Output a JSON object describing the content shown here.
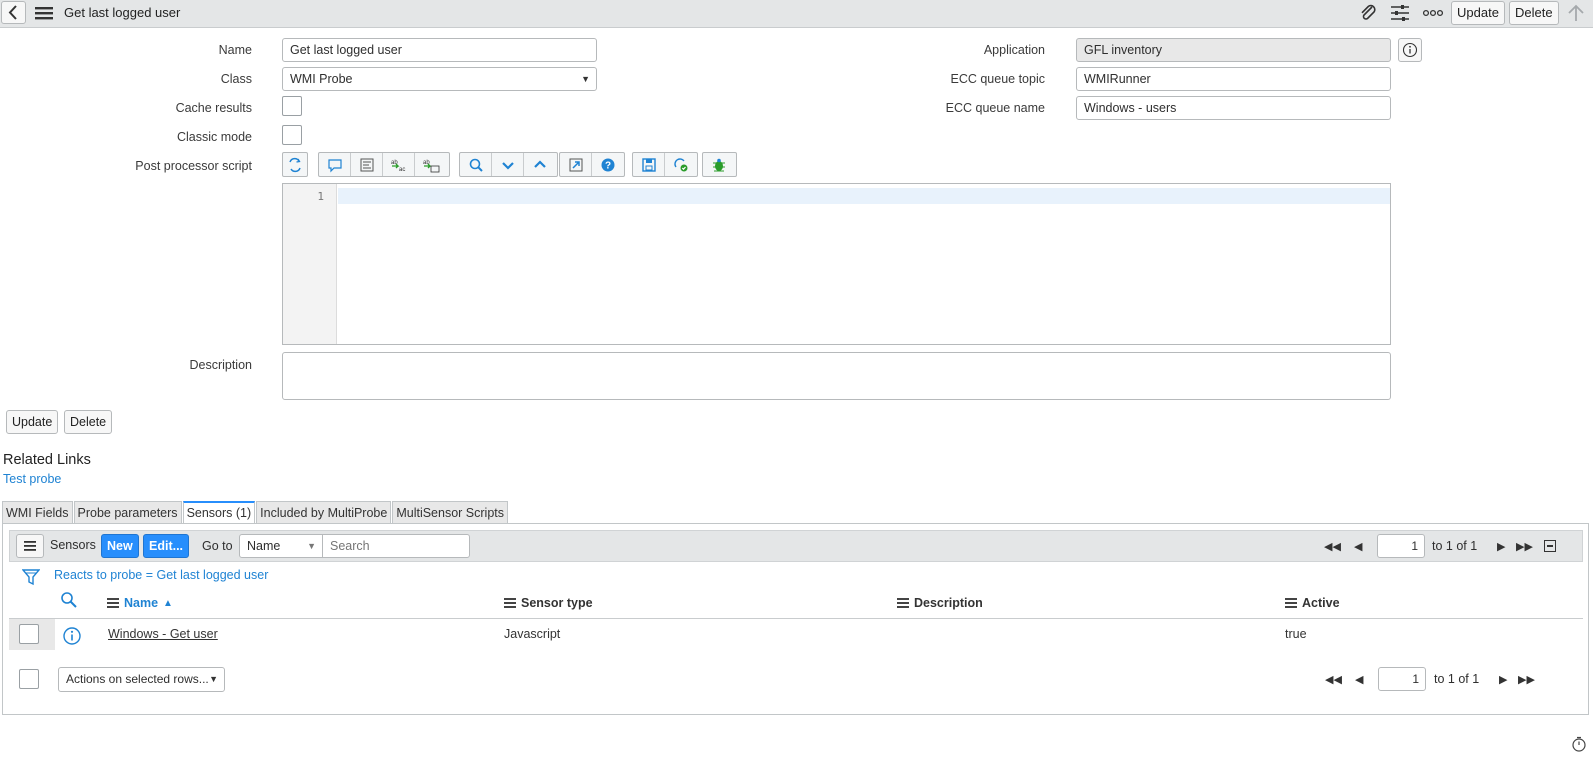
{
  "header": {
    "title": "Get last logged user",
    "update_label": "Update",
    "delete_label": "Delete"
  },
  "form": {
    "name_label": "Name",
    "name_value": "Get last logged user",
    "class_label": "Class",
    "class_value": "WMI Probe",
    "cache_label": "Cache results",
    "classic_label": "Classic mode",
    "script_label": "Post processor script",
    "line_number": "1",
    "description_label": "Description",
    "application_label": "Application",
    "application_value": "GFL inventory",
    "ecc_topic_label": "ECC queue topic",
    "ecc_topic_value": "WMIRunner",
    "ecc_name_label": "ECC queue name",
    "ecc_name_value": "Windows - users",
    "update_label": "Update",
    "delete_label": "Delete"
  },
  "related": {
    "title": "Related Links",
    "link": "Test probe"
  },
  "tabs": [
    {
      "label": "WMI Fields"
    },
    {
      "label": "Probe parameters"
    },
    {
      "label": "Sensors (1)"
    },
    {
      "label": "Included by MultiProbe"
    },
    {
      "label": "MultiSensor Scripts"
    }
  ],
  "list": {
    "title": "Sensors",
    "new_label": "New",
    "edit_label": "Edit...",
    "goto_label": "Go to",
    "goto_field": "Name",
    "search_placeholder": "Search",
    "page": "1",
    "page_total": "to 1 of 1",
    "filter_text": "Reacts to probe = Get last logged user",
    "columns": [
      "Name",
      "Sensor type",
      "Description",
      "Active"
    ],
    "rows": [
      {
        "name": "Windows - Get user",
        "type": "Javascript",
        "description": "",
        "active": "true"
      }
    ],
    "actions_label": "Actions on selected rows..."
  },
  "colors": {
    "accent": "#278efc",
    "link": "#1f83d3"
  }
}
